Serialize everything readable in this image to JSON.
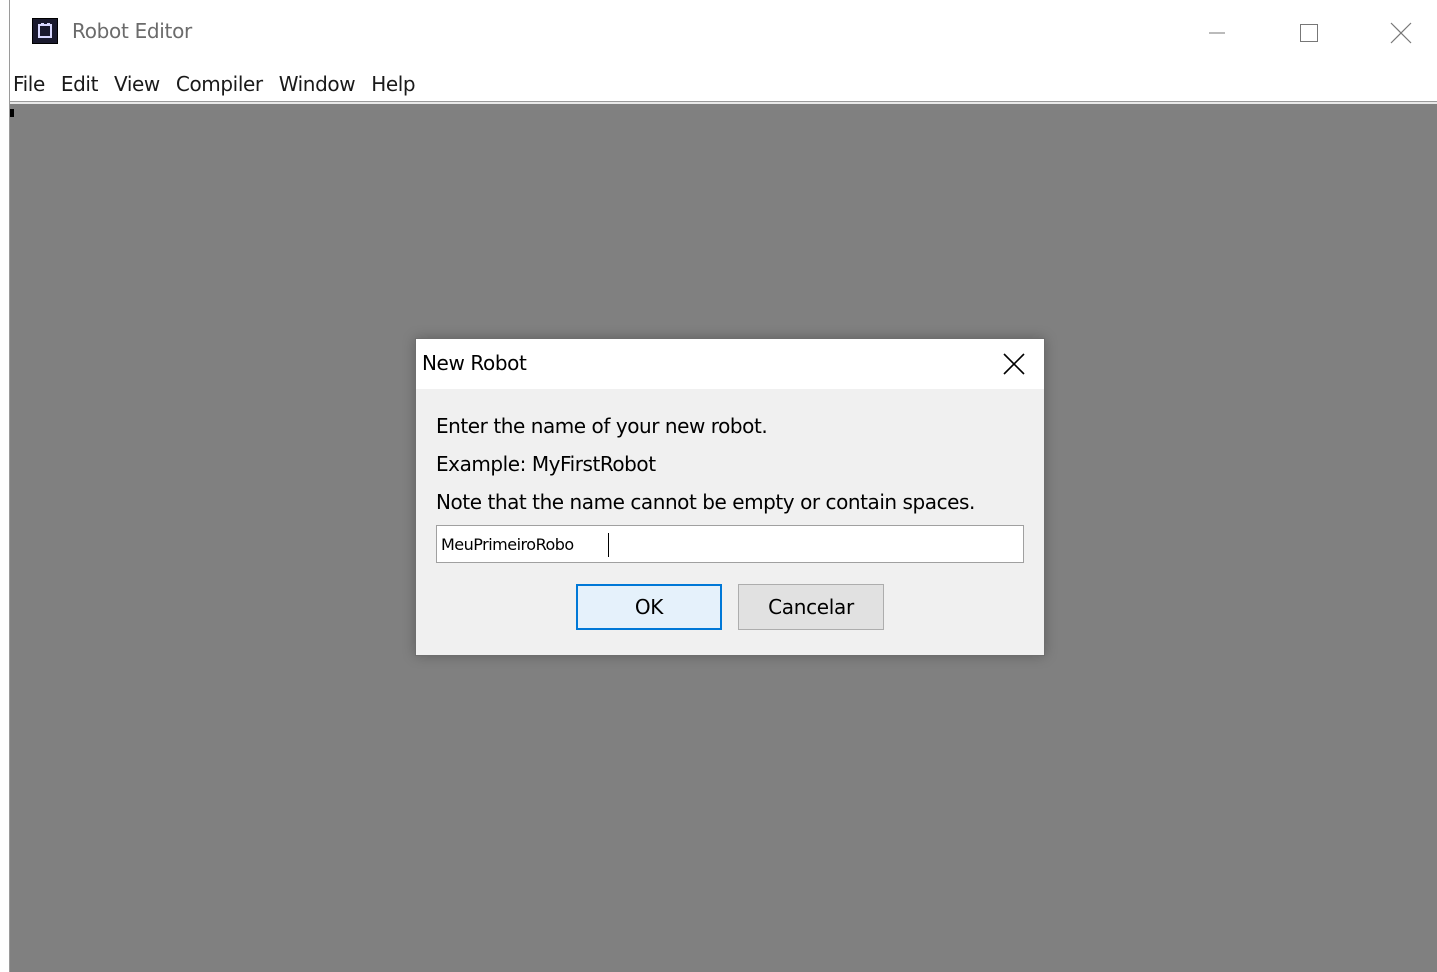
{
  "window": {
    "title": "Robot Editor",
    "icon": "robot-app-icon",
    "controls": {
      "minimize_icon": "minimize-icon",
      "maximize_icon": "maximize-icon",
      "close_icon": "close-icon"
    }
  },
  "menubar": {
    "items": [
      {
        "label": "File"
      },
      {
        "label": "Edit"
      },
      {
        "label": "View"
      },
      {
        "label": "Compiler"
      },
      {
        "label": "Window"
      },
      {
        "label": "Help"
      }
    ]
  },
  "colors": {
    "desktop_background": "#808080",
    "dialog_background": "#f0f0f0",
    "ok_button_border": "#0078d7"
  },
  "dialog": {
    "title": "New Robot",
    "messages": [
      "Enter the name of your new robot.",
      "Example: MyFirstRobot",
      "Note that the name cannot be empty or contain spaces."
    ],
    "input_value": "MeuPrimeiroRobo",
    "ok_label": "OK",
    "cancel_label": "Cancelar"
  }
}
